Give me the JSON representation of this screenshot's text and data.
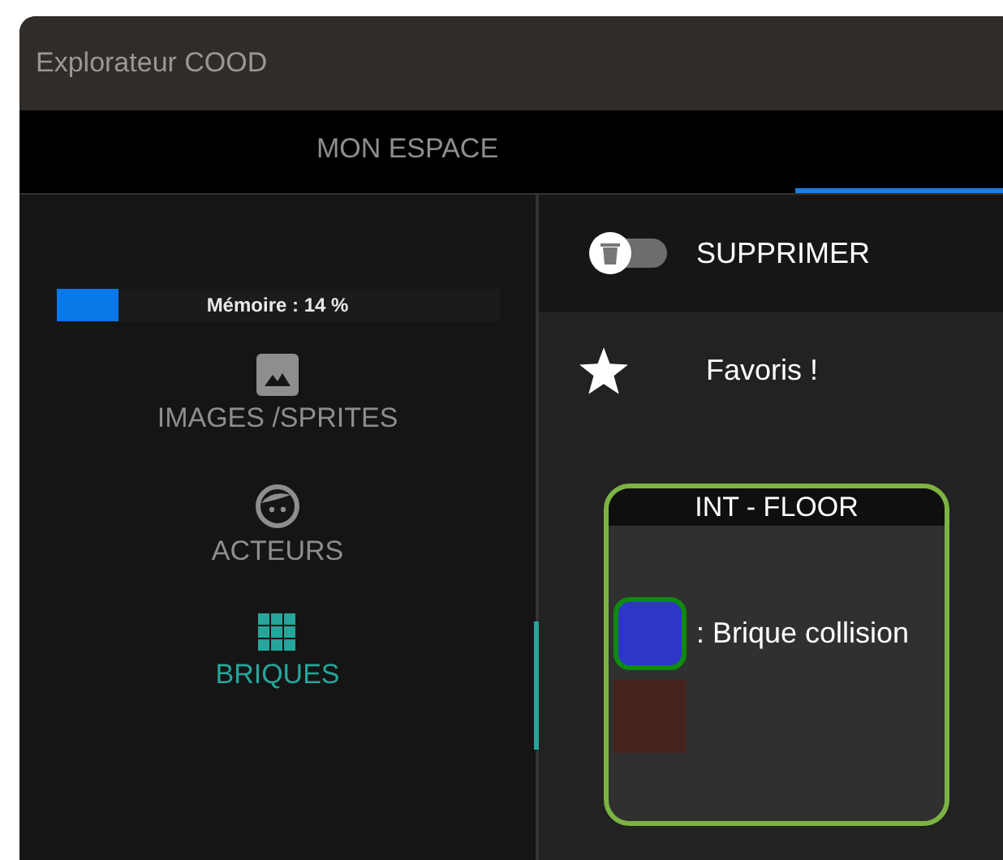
{
  "window": {
    "title": "Explorateur COOD"
  },
  "tabs": [
    {
      "label": "MON ESPACE",
      "selected": false
    },
    {
      "selected": true
    }
  ],
  "memory": {
    "label": "Mémoire : 14 %",
    "level": 0.14
  },
  "sidebar": {
    "items": [
      {
        "kind": "image",
        "label": "IMAGES /SPRITES",
        "selected": false
      },
      {
        "kind": "face",
        "label": "ACTEURS",
        "selected": false
      },
      {
        "kind": "grid",
        "label": "BRIQUES",
        "selected": true
      }
    ]
  },
  "delete_toggle": {
    "label": "SUPPRIMER",
    "on": false
  },
  "favorites": {
    "label": "Favoris !"
  },
  "card": {
    "title": "INT - FLOOR",
    "bricks": [
      {
        "color": "#2e36c8",
        "selected": true,
        "label": ": Brique collision"
      },
      {
        "color": "#45241d",
        "selected": false
      }
    ]
  }
}
